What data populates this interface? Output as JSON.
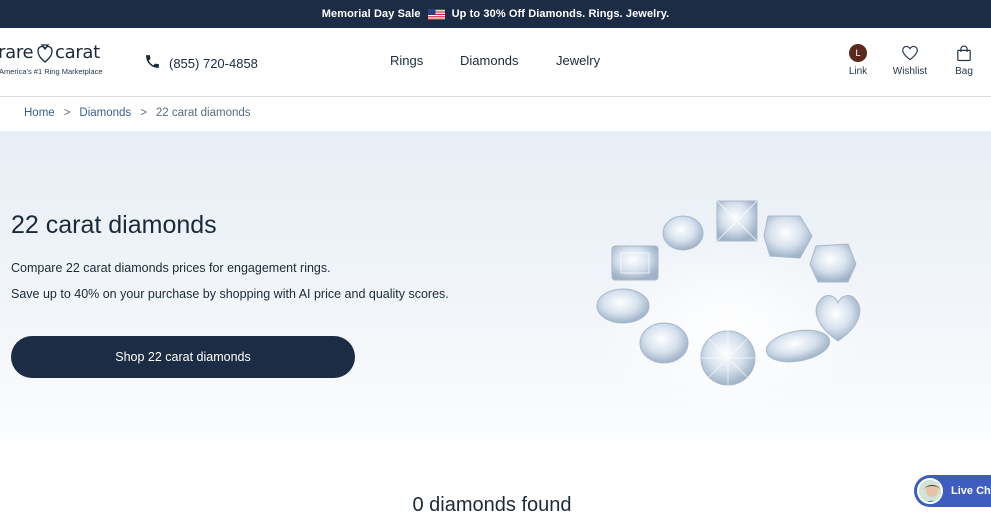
{
  "promo": {
    "left_text": "Memorial Day Sale",
    "right_text": "Up to 30% Off Diamonds. Rings. Jewelry.",
    "flag_icon": "us-flag-icon"
  },
  "header": {
    "logo_left": "rare",
    "logo_right": "carat",
    "logo_icon": "heart-diamond-icon",
    "tagline": "America's #1 Ring Marketplace",
    "phone": "(855) 720-4858",
    "nav": [
      "Rings",
      "Diamonds",
      "Jewelry"
    ],
    "utility": {
      "account_initial": "L",
      "account_label": "Link",
      "wishlist_label": "Wishlist",
      "bag_label": "Bag"
    }
  },
  "breadcrumb": {
    "home": "Home",
    "sep": ">",
    "diamonds": "Diamonds",
    "current": "22 carat diamonds"
  },
  "hero": {
    "title": "22 carat diamonds",
    "line1": "Compare 22 carat diamonds prices for engagement rings.",
    "line2": "Save up to 40% on your purchase by shopping with AI price and quality scores.",
    "cta": "Shop 22 carat diamonds"
  },
  "results": {
    "count_text": "0 diamonds found"
  },
  "chat": {
    "label": "Live Ch"
  },
  "colors": {
    "navy": "#1c2c44",
    "link": "#3a5f8c",
    "chat": "#3f5dc0",
    "hero_bg": "#e7eef5"
  }
}
